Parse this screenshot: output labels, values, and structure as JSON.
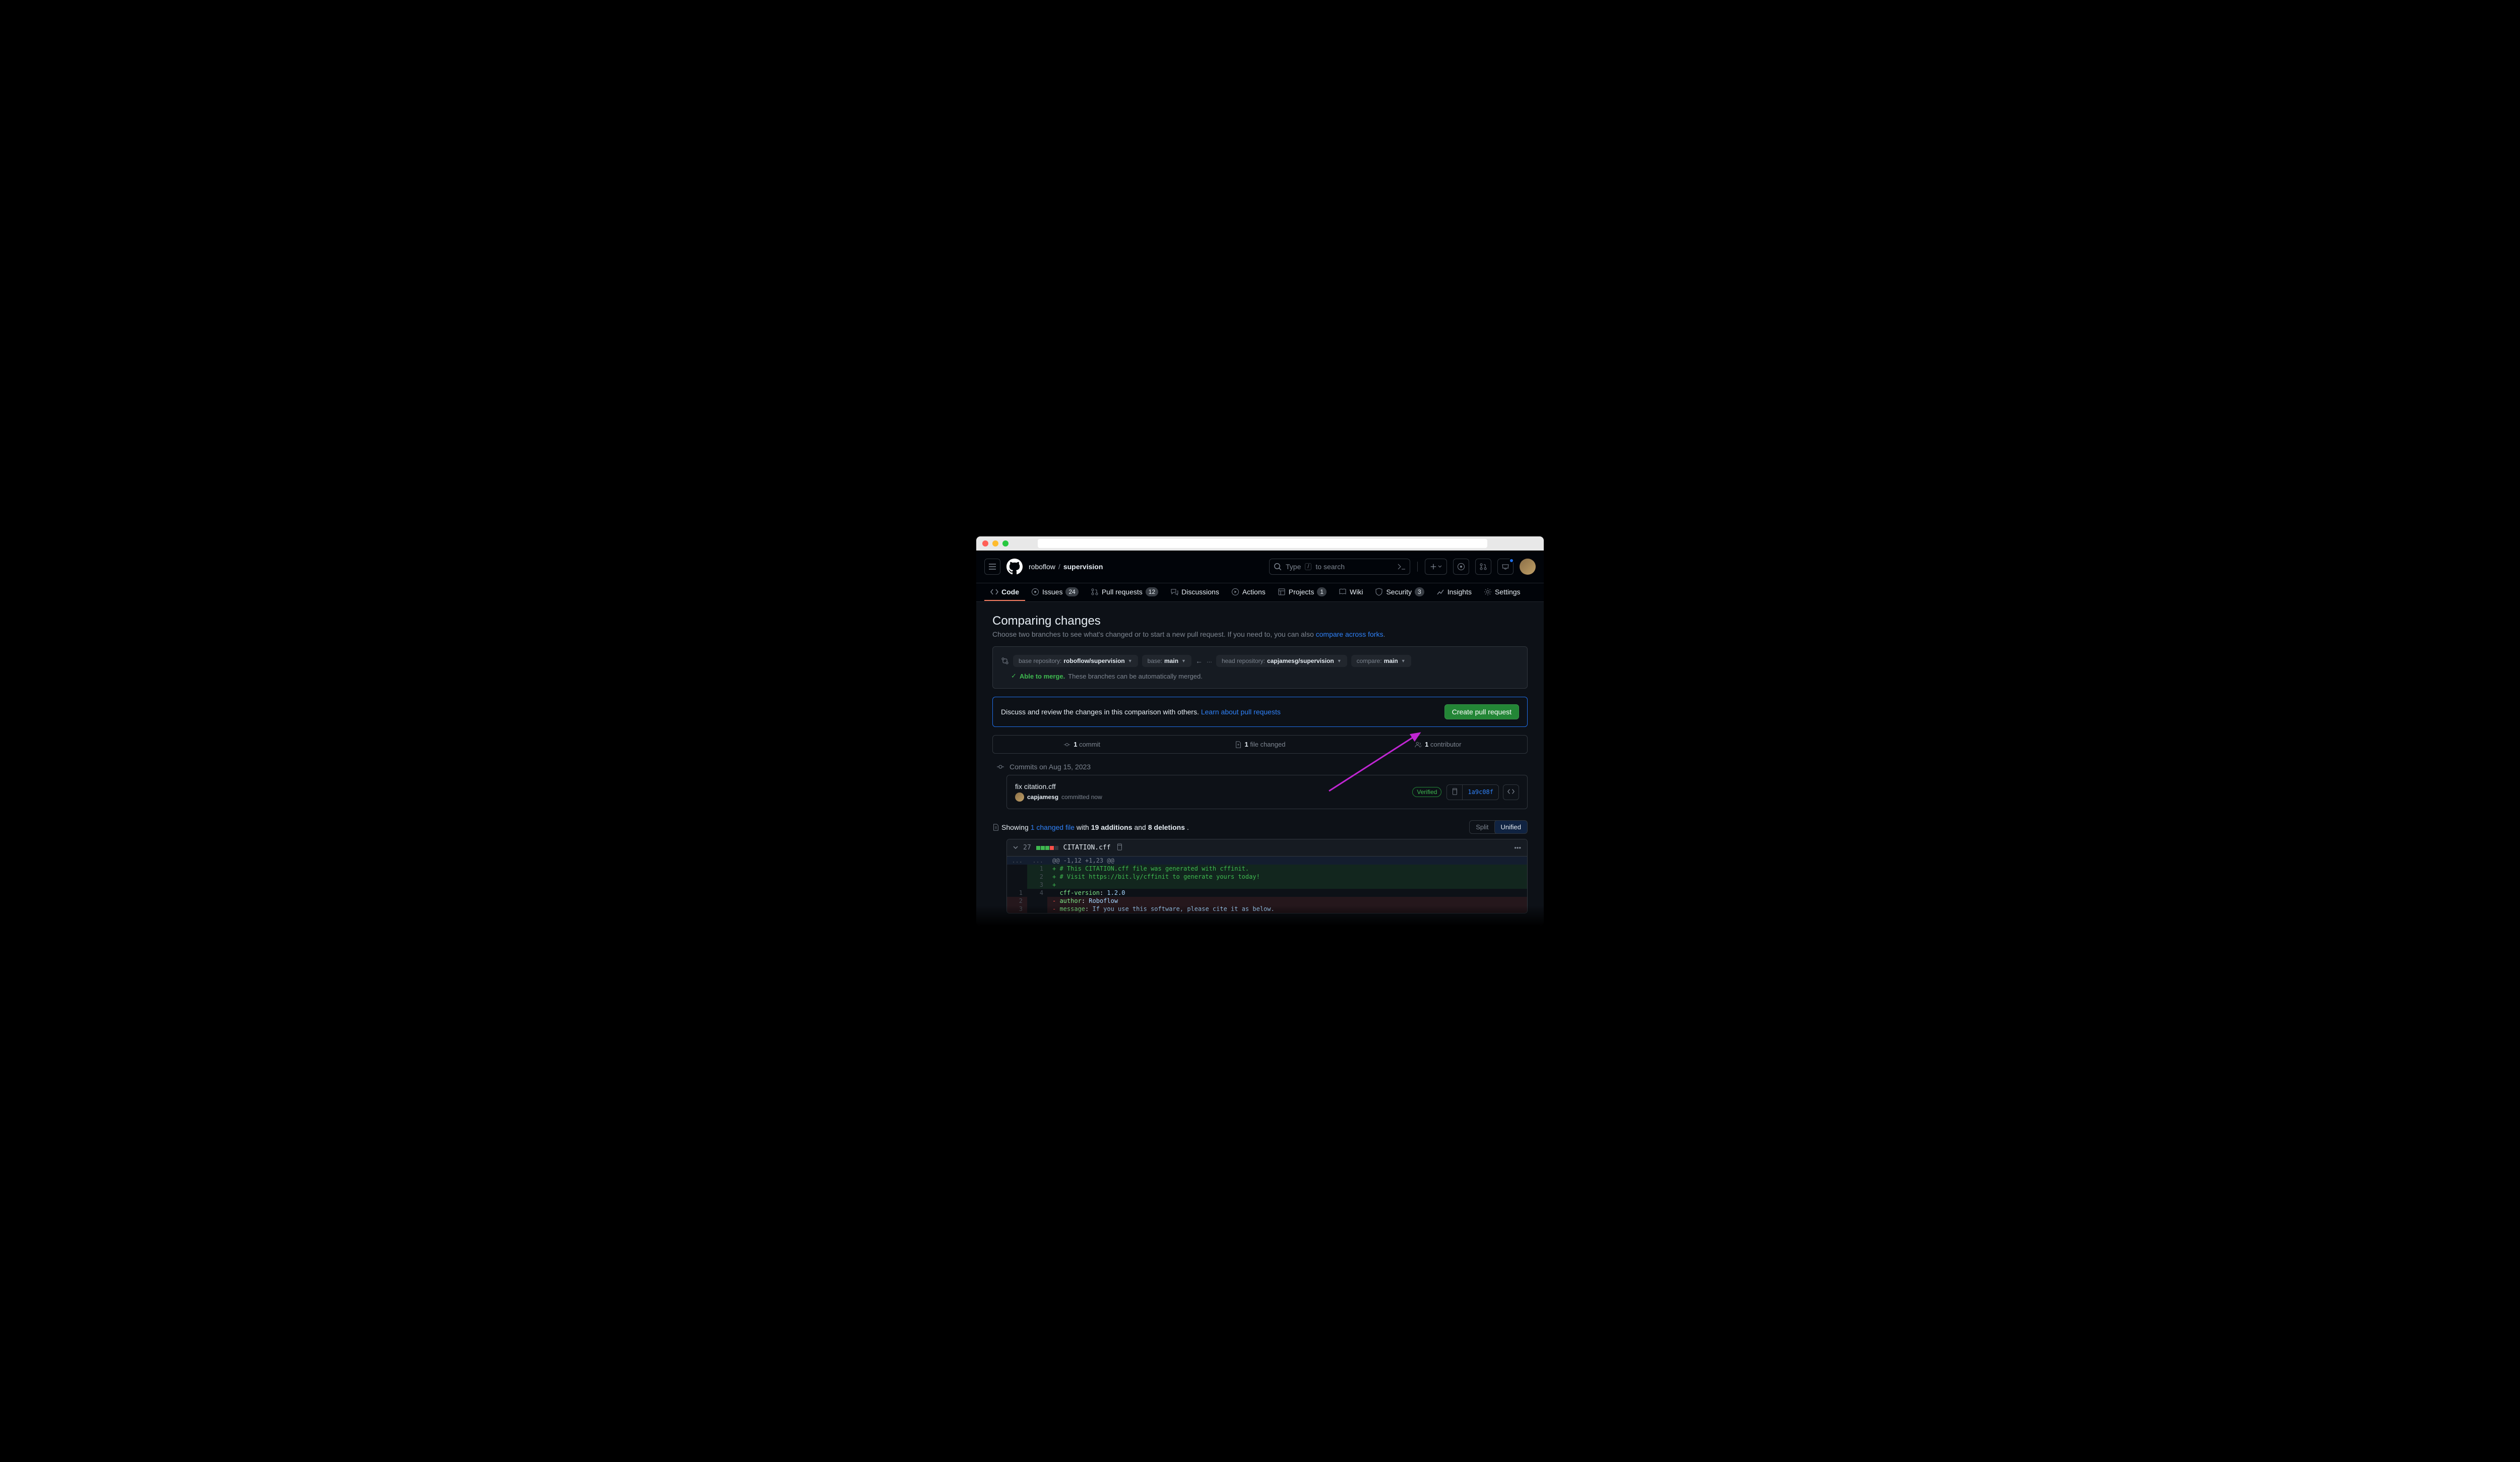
{
  "breadcrumb": {
    "owner": "roboflow",
    "repo": "supervision"
  },
  "search": {
    "placeholder_pre": "Type ",
    "key": "/",
    "placeholder_post": " to search"
  },
  "tabs": {
    "code": "Code",
    "issues": {
      "label": "Issues",
      "count": "24"
    },
    "pulls": {
      "label": "Pull requests",
      "count": "12"
    },
    "discussions": "Discussions",
    "actions": "Actions",
    "projects": {
      "label": "Projects",
      "count": "1"
    },
    "wiki": "Wiki",
    "security": {
      "label": "Security",
      "count": "3"
    },
    "insights": "Insights",
    "settings": "Settings"
  },
  "page": {
    "title": "Comparing changes",
    "subtitle_pre": "Choose two branches to see what's changed or to start a new pull request. If you need to, you can also ",
    "subtitle_link": "compare across forks",
    "subtitle_post": "."
  },
  "compare": {
    "base_repo_label": "base repository: ",
    "base_repo_value": "roboflow/supervision",
    "base_label": "base: ",
    "base_value": "main",
    "head_repo_label": "head repository: ",
    "head_repo_value": "capjamesg/supervision",
    "compare_label": "compare: ",
    "compare_value": "main",
    "merge_ok": "Able to merge.",
    "merge_desc": " These branches can be automatically merged."
  },
  "banner": {
    "text": "Discuss and review the changes in this comparison with others. ",
    "link": "Learn about pull requests",
    "button": "Create pull request"
  },
  "stats": {
    "commits_n": "1",
    "commits_label": " commit",
    "files_n": "1",
    "files_label": " file changed",
    "contribs_n": "1",
    "contribs_label": " contributor"
  },
  "commits": {
    "date": "Commits on Aug 15, 2023",
    "title": "fix citation.cff",
    "author": "capjamesg",
    "when": " committed now",
    "verified": "Verified",
    "sha": "1a9c08f"
  },
  "diffsum": {
    "showing": "Showing ",
    "file_link": "1 changed file",
    "with": " with ",
    "adds": "19 additions",
    "and": " and ",
    "dels": "8 deletions",
    "dot": ".",
    "split": "Split",
    "unified": "Unified"
  },
  "file": {
    "count": "27",
    "name": "CITATION.cff"
  },
  "lines": {
    "hunk": "@@ -1,12 +1,23 @@",
    "a1": "+ # This CITATION.cff file was generated with cffinit.",
    "a2": "+ # Visit https://bit.ly/cffinit to generate yours today!",
    "a3": "+ ",
    "c1_pre": "  ",
    "c1_key": "cff-version",
    "c1_sep": ": ",
    "c1_val": "1.2.0",
    "d1_pre": "- ",
    "d1_key": "author",
    "d1_sep": ": ",
    "d1_val": "Roboflow",
    "d2_pre": "- ",
    "d2_key": "message",
    "d2_sep": ": ",
    "d2_val": "If you use this software, please cite it as below."
  }
}
